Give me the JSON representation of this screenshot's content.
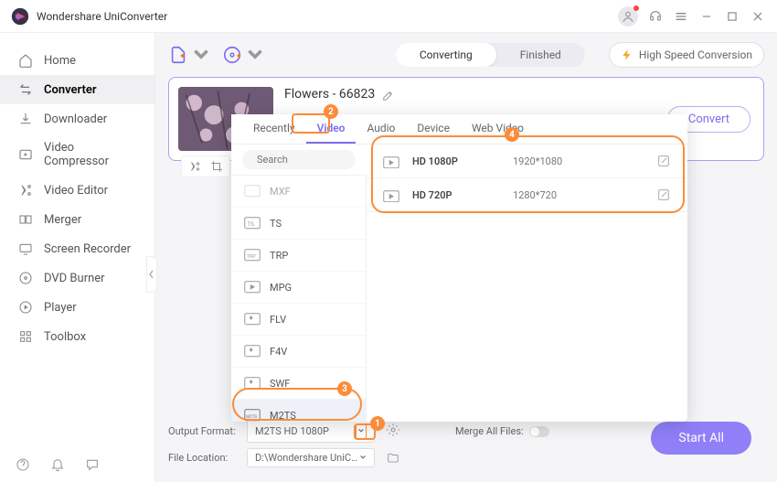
{
  "app": {
    "title": "Wondershare UniConverter"
  },
  "sidebar": {
    "items": [
      {
        "label": "Home"
      },
      {
        "label": "Converter"
      },
      {
        "label": "Downloader"
      },
      {
        "label": "Video Compressor"
      },
      {
        "label": "Video Editor"
      },
      {
        "label": "Merger"
      },
      {
        "label": "Screen Recorder"
      },
      {
        "label": "DVD Burner"
      },
      {
        "label": "Player"
      },
      {
        "label": "Toolbox"
      }
    ]
  },
  "segment": {
    "converting": "Converting",
    "finished": "Finished"
  },
  "hs": {
    "label": "High Speed Conversion"
  },
  "file": {
    "name": "Flowers - 66823"
  },
  "convert": {
    "label": "Convert"
  },
  "tabs": {
    "recently": "Recently",
    "video": "Video",
    "audio": "Audio",
    "device": "Device",
    "webvideo": "Web Video"
  },
  "search": {
    "placeholder": "Search"
  },
  "formats": {
    "mxf": "MXF",
    "ts": "TS",
    "trp": "TRP",
    "mpg": "MPG",
    "flv": "FLV",
    "f4v": "F4V",
    "swf": "SWF",
    "m2ts": "M2TS"
  },
  "qualities": [
    {
      "name": "HD 1080P",
      "res": "1920*1080"
    },
    {
      "name": "HD 720P",
      "res": "1280*720"
    }
  ],
  "footer": {
    "output_label": "Output Format:",
    "output_value": "M2TS HD 1080P",
    "location_label": "File Location:",
    "location_value": "D:\\Wondershare UniConverter",
    "merge_label": "Merge All Files:"
  },
  "startall": {
    "label": "Start All"
  },
  "badges": {
    "b1": "1",
    "b2": "2",
    "b3": "3",
    "b4": "4"
  }
}
